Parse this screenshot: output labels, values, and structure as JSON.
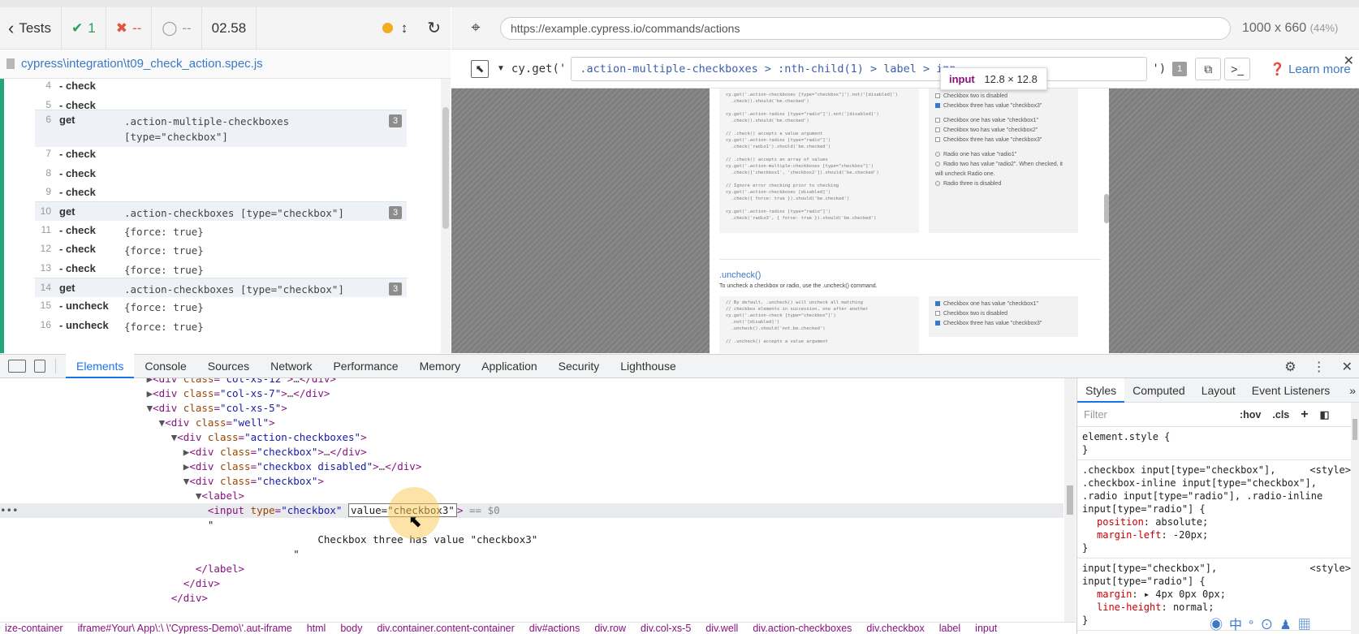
{
  "reporter": {
    "tests_label": "Tests",
    "passed": "1",
    "failed": "--",
    "pending": "--",
    "duration": "02.58",
    "spec_path": "cypress\\integration\\t09_check_action.spec.js"
  },
  "commands": [
    {
      "num": "4",
      "name": "- check",
      "msg": "",
      "badge": ""
    },
    {
      "num": "5",
      "name": "- check",
      "msg": "",
      "badge": ""
    },
    {
      "num": "6",
      "name": "get",
      "msg": ".action-multiple-checkboxes",
      "msg2": "[type=\"checkbox\"]",
      "badge": "3"
    },
    {
      "num": "7",
      "name": "- check",
      "msg": "",
      "badge": ""
    },
    {
      "num": "8",
      "name": "- check",
      "msg": "",
      "badge": ""
    },
    {
      "num": "9",
      "name": "- check",
      "msg": "",
      "badge": ""
    },
    {
      "num": "10",
      "name": "get",
      "msg": ".action-checkboxes [type=\"checkbox\"]",
      "badge": "3"
    },
    {
      "num": "11",
      "name": "- check",
      "msg": "{force: true}",
      "badge": ""
    },
    {
      "num": "12",
      "name": "- check",
      "msg": "{force: true}",
      "badge": ""
    },
    {
      "num": "13",
      "name": "- check",
      "msg": "{force: true}",
      "badge": ""
    },
    {
      "num": "14",
      "name": "get",
      "msg": ".action-checkboxes [type=\"checkbox\"]",
      "badge": "3"
    },
    {
      "num": "15",
      "name": "- uncheck",
      "msg": "{force: true}",
      "badge": ""
    },
    {
      "num": "16",
      "name": "- uncheck",
      "msg": "{force: true}",
      "badge": ""
    }
  ],
  "aut": {
    "url": "https://example.cypress.io/commands/actions",
    "viewport": "1000 x 660",
    "zoom": "(44%)"
  },
  "playground": {
    "cy_get": "cy.get('",
    "selector": ".action-multiple-checkboxes > :nth-child(1) > label > inp",
    "close_paren": "')",
    "count": "1",
    "learn_more": "Learn more"
  },
  "tooltip": {
    "tag": "input",
    "size": "12.8 × 12.8"
  },
  "aut_page": {
    "code1": "cy.get('.action-checkboxes [type=\"checkbox\"]').not('[disabled]')\n  .check().should('be.checked')\n\ncy.get('.action-radios [type=\"radio\"]').not('[disabled]')\n  .check().should('be.checked')\n\n// .check() accepts a value argument\ncy.get('.action-radios [type=\"radio\"]')\n  .check('radio1').should('be.checked')\n\n// .check() accepts an array of values\ncy.get('.action-multiple-checkboxes [type=\"checkbox\"]')\n  .check(['checkbox1', 'checkbox2']).should('be.checked')\n\n// Ignore error checking prior to checking\ncy.get('.action-checkboxes [disabled]')\n  .check({ force: true }).should('be.checked')\n\ncy.get('.action-radios [type=\"radio\"]')\n  .check('radio3', { force: true }).should('be.checked')",
    "well1": [
      "Checkbox two is disabled",
      "Checkbox three has value \"checkbox3\""
    ],
    "well2": [
      "Checkbox one has value \"checkbox1\"",
      "Checkbox two has value \"checkbox2\"",
      "Checkbox three has value \"checkbox3\""
    ],
    "radios": [
      "Radio one has value \"radio1\"",
      "Radio two has value \"radio2\". When checked, it will uncheck Radio one.",
      "Radio three is disabled"
    ],
    "uncheck_title": ".uncheck()",
    "uncheck_desc": "To uncheck a checkbox or radio, use the .uncheck() command.",
    "code2": "// By default, .uncheck() will uncheck all matching\n// checkbox elements in succession, one after another\ncy.get('.action-check [type=\"checkbox\"]')\n  .not('[disabled]')\n  .uncheck().should('not.be.checked')\n\n// .uncheck() accepts a value argument",
    "well3": [
      "Checkbox one has value \"checkbox1\"",
      "Checkbox two is disabled",
      "Checkbox three has value \"checkbox3\""
    ]
  },
  "devtools": {
    "tabs": [
      "Elements",
      "Console",
      "Sources",
      "Network",
      "Performance",
      "Memory",
      "Application",
      "Security",
      "Lighthouse"
    ],
    "styles_tabs": [
      "Styles",
      "Computed",
      "Layout",
      "Event Listeners"
    ],
    "filter_placeholder": "Filter",
    "hov": ":hov",
    "cls": ".cls",
    "dom_text": "Checkbox three has value \"checkbox3\"",
    "breadcrumb": [
      "ize-container",
      "iframe#Your\\ App\\:\\ \\'Cypress-Demo\\'.aut-iframe",
      "html",
      "body",
      "div.container.content-container",
      "div#actions",
      "div.row",
      "div.col-xs-5",
      "div.well",
      "div.action-checkboxes",
      "div.checkbox",
      "label",
      "input"
    ],
    "rules": [
      {
        "selector": "element.style {",
        "src": "",
        "props": [],
        "close": "}"
      },
      {
        "selector": ".checkbox input[type=\"checkbox\"],\n.checkbox-inline input[type=\"checkbox\"],\n.radio input[type=\"radio\"], .radio-inline\ninput[type=\"radio\"] {",
        "src": "<style>",
        "props": [
          [
            "position",
            "absolute;"
          ],
          [
            "margin-left",
            "-20px;"
          ]
        ],
        "close": "}"
      },
      {
        "selector": "input[type=\"checkbox\"],\ninput[type=\"radio\"] {",
        "src": "<style>",
        "props": [
          [
            "margin",
            "▸ 4px 0px 0px;"
          ],
          [
            "line-height",
            "normal;"
          ]
        ],
        "close": "}"
      }
    ]
  }
}
